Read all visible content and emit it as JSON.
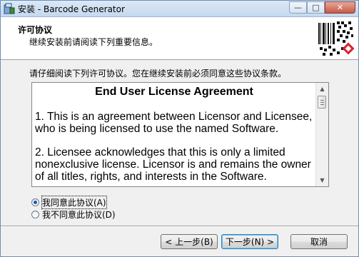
{
  "window": {
    "title": "安装 - Barcode Generator",
    "buttons": {
      "minimize": "—",
      "maximize": "□",
      "close": "✕"
    }
  },
  "header": {
    "title": "许可协议",
    "subtitle": "继续安装前请阅读下列重要信息。"
  },
  "instruction": "请仔细阅读下列许可协议。您在继续安装前必须同意这些协议条款。",
  "license": {
    "heading": "End User License Agreement",
    "paragraphs": [
      "1. This is an agreement between Licensor and Licensee, who is being licensed to use the named Software.",
      "2. Licensee acknowledges that this is only a limited nonexclusive license. Licensor is and remains the owner of all titles, rights, and interests in the Software."
    ]
  },
  "options": {
    "accept": "我同意此协议(A)",
    "decline": "我不同意此协议(D)",
    "selected": "accept"
  },
  "buttons": {
    "back": "< 上一步(B)",
    "next": "下一步(N) >",
    "cancel": "取消"
  },
  "colors": {
    "accent": "#1a57b6",
    "titlebar": "#c4d9ef"
  }
}
